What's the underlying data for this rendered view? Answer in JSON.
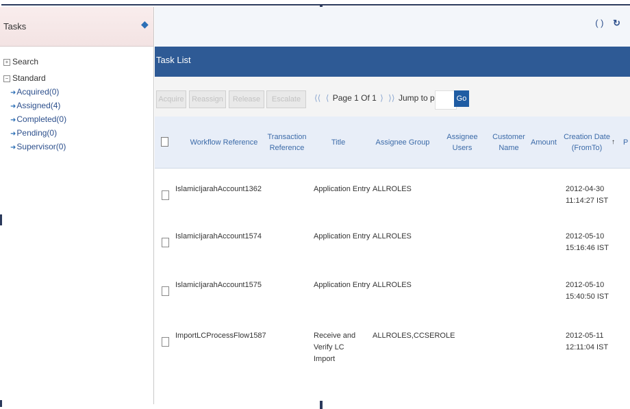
{
  "left_panel": {
    "title": "Tasks",
    "tree": [
      {
        "label": "Search",
        "expanded": false,
        "toggle": "+"
      },
      {
        "label": "Standard",
        "expanded": true,
        "toggle": "−",
        "children": [
          {
            "label": "Acquired(0)"
          },
          {
            "label": "Assigned(4)"
          },
          {
            "label": "Completed(0)"
          },
          {
            "label": "Pending(0)"
          },
          {
            "label": "Supervisor(0)"
          }
        ]
      }
    ]
  },
  "toolbar": {
    "icons": [
      "brackets-icon",
      "refresh-icon"
    ],
    "bracket_glyph": "( )",
    "refresh_glyph": "↻"
  },
  "task_list": {
    "title": "Task List",
    "actions": [
      "Acquire",
      "Reassign",
      "Release",
      "Escalate"
    ],
    "pager": {
      "first": "⟨⟨",
      "prev": "⟨",
      "page_text": "Page 1 Of 1",
      "next": "⟩",
      "last": "⟩⟩"
    },
    "jump_label": "Jump to page",
    "jump_value": "",
    "go_label": "Go",
    "columns": [
      "Workflow Reference",
      "Transaction Reference",
      "Title",
      "Assignee Group",
      "Assignee Users",
      "Customer Name",
      "Amount",
      "Creation Date (FromTo)",
      "P"
    ],
    "rows": [
      {
        "workflow_reference": "IslamicIjarahAccount1362",
        "transaction_reference": "",
        "title": "Application Entry",
        "assignee_group": "ALLROLES",
        "assignee_users": "",
        "customer_name": "",
        "amount": "",
        "creation_date": "2012-04-30",
        "creation_time": "11:14:27 IST"
      },
      {
        "workflow_reference": "IslamicIjarahAccount1574",
        "transaction_reference": "",
        "title": "Application Entry",
        "assignee_group": "ALLROLES",
        "assignee_users": "",
        "customer_name": "",
        "amount": "",
        "creation_date": "2012-05-10",
        "creation_time": "15:16:46 IST"
      },
      {
        "workflow_reference": "IslamicIjarahAccount1575",
        "transaction_reference": "",
        "title": "Application Entry",
        "assignee_group": "ALLROLES",
        "assignee_users": "",
        "customer_name": "",
        "amount": "",
        "creation_date": "2012-05-10",
        "creation_time": "15:40:50 IST"
      },
      {
        "workflow_reference": "ImportLCProcessFlow1587",
        "transaction_reference": "",
        "title": "Receive and Verify LC Import",
        "assignee_group": "ALLROLES,CCSEROLE",
        "assignee_users": "",
        "customer_name": "",
        "amount": "",
        "creation_date": "2012-05-11",
        "creation_time": "12:11:04 IST"
      }
    ]
  },
  "colors": {
    "header_blue": "#2e5a95",
    "link_blue": "#3b6aa8",
    "go_button": "#1f5ca3",
    "tasks_header_bg": "#f3e3e3"
  }
}
